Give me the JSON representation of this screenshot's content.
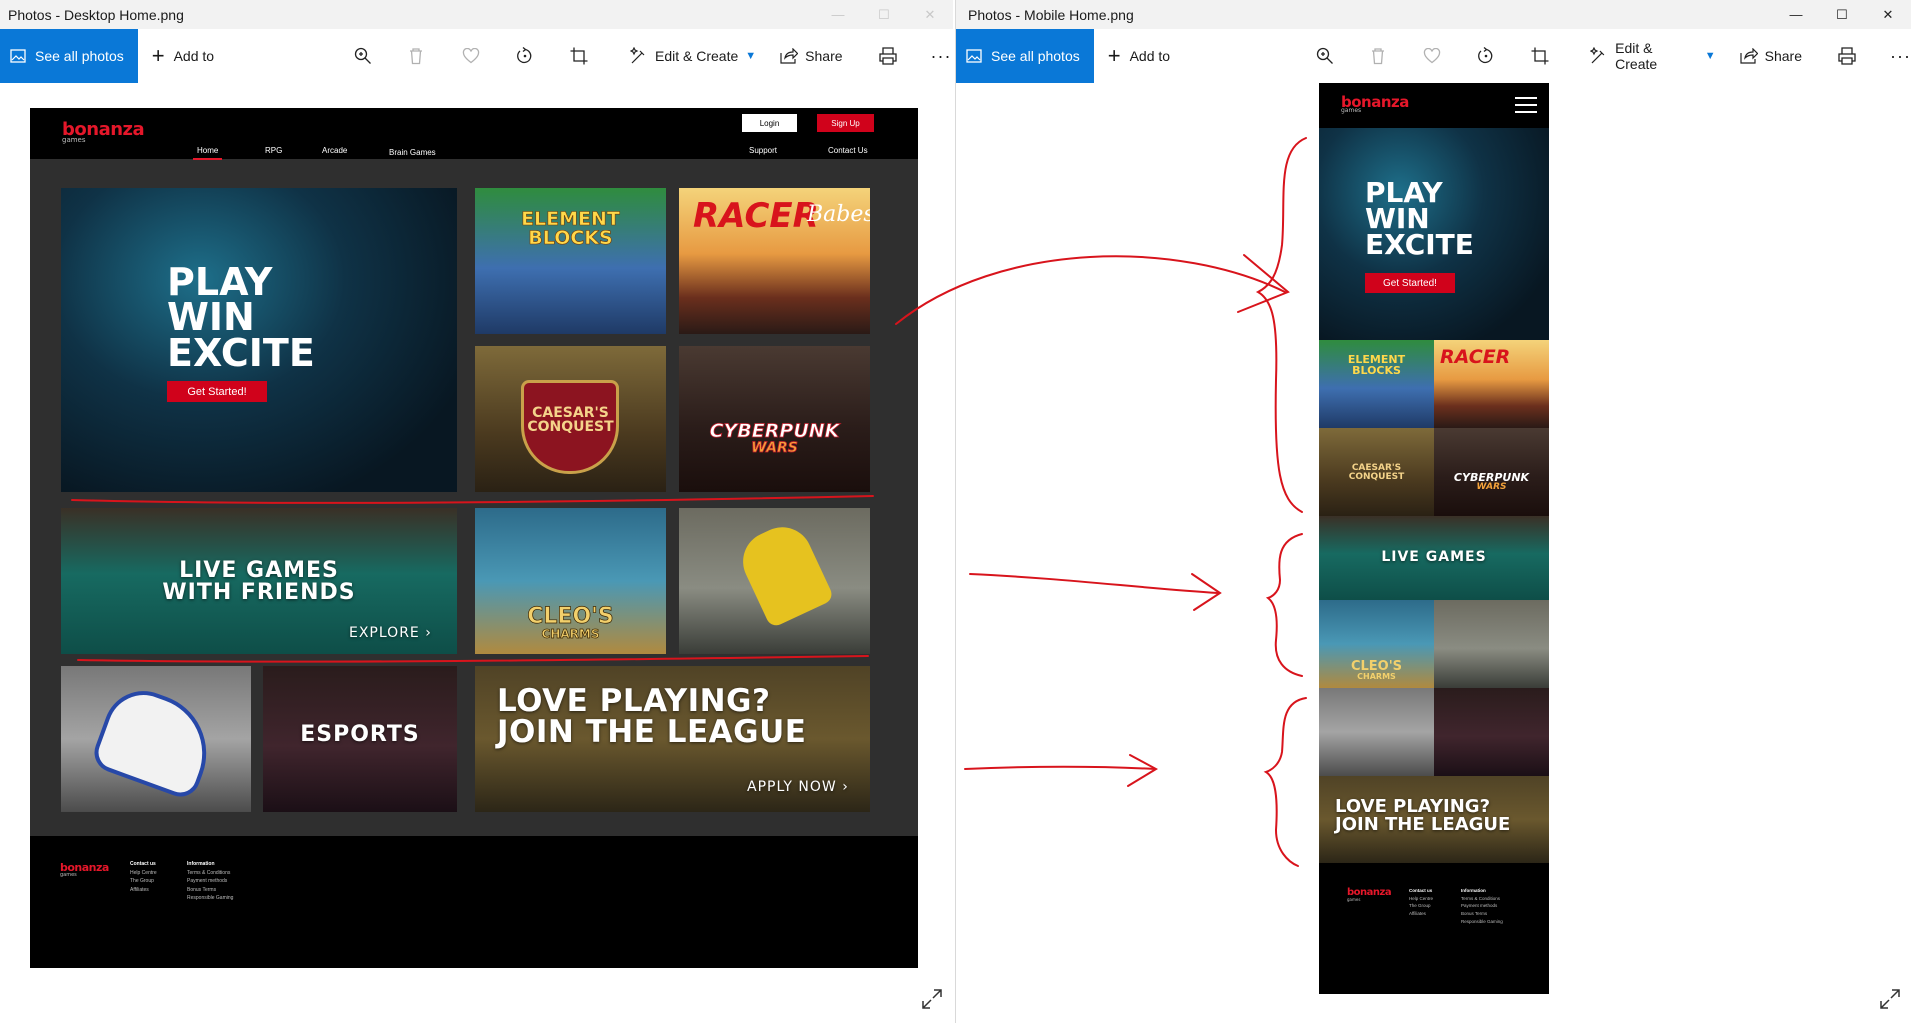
{
  "left_window": {
    "title": "Photos - Desktop Home.png",
    "toolbar": {
      "see_all": "See all photos",
      "add_to": "Add to",
      "edit_create": "Edit & Create",
      "share": "Share"
    }
  },
  "right_window": {
    "title": "Photos - Mobile Home.png",
    "toolbar": {
      "see_all": "See all photos",
      "add_to": "Add to",
      "edit_create": "Edit & Create",
      "share": "Share"
    }
  },
  "desktop_site": {
    "logo": "bonanza",
    "logo_sub": "games",
    "nav": [
      "Home",
      "RPG",
      "Arcade",
      "Brain Games"
    ],
    "nav_right": [
      "Support",
      "Contact Us"
    ],
    "login": "Login",
    "signup": "Sign Up",
    "hero": {
      "line1": "PLAY",
      "line2": "WIN",
      "line3": "EXCITE",
      "cta": "Get Started!"
    },
    "games": {
      "element_blocks_1": "ELEMENT",
      "element_blocks_2": "BLOCKS",
      "racer": "RACER",
      "racer_script": "Babes",
      "caesar_1": "CAESAR'S",
      "caesar_2": "CONQUEST",
      "cyber_1": "CYBERPUNK",
      "cyber_2": "WARS",
      "cleo_1": "CLEO'S",
      "cleo_2": "CHARMS"
    },
    "live": {
      "line1": "LIVE GAMES",
      "line2": "WITH FRIENDS",
      "link": "EXPLORE"
    },
    "esports": "ESPORTS",
    "league": {
      "line1": "LOVE PLAYING?",
      "line2": "JOIN THE LEAGUE",
      "link": "APPLY NOW"
    },
    "footer": {
      "col1_title": "Contact us",
      "col1_items": [
        "Help Centre",
        "The Group",
        "Affiliates"
      ],
      "col2_title": "Information",
      "col2_items": [
        "Terms & Conditions",
        "Payment methods",
        "Bonus Terms",
        "Responsible Gaming"
      ]
    }
  },
  "mobile_site": {
    "logo": "bonanza",
    "logo_sub": "games",
    "hero": {
      "line1": "PLAY",
      "line2": "WIN",
      "line3": "EXCITE",
      "cta": "Get Started!"
    },
    "live": "LIVE GAMES",
    "league": {
      "line1": "LOVE PLAYING?",
      "line2": "JOIN THE LEAGUE"
    },
    "footer": {
      "col1_title": "Contact us",
      "col1_items": [
        "Help Centre",
        "The Group",
        "Affiliates"
      ],
      "col2_title": "Information",
      "col2_items": [
        "Terms & Conditions",
        "Payment methods",
        "Bonus Terms",
        "Responsible Gaming"
      ]
    }
  },
  "colors": {
    "accent": "#0a78d7",
    "brand_red": "#e5172a",
    "annotation_red": "#d8141c"
  }
}
